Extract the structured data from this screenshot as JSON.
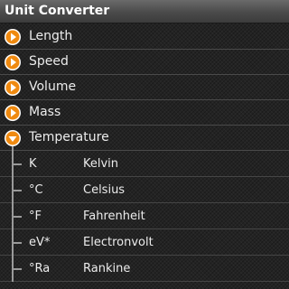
{
  "app": {
    "title": "Unit Converter"
  },
  "colors": {
    "accent": "#f08a10",
    "background": "#232323",
    "divider": "#4a4a4a"
  },
  "categories": [
    {
      "label": "Length",
      "state": "collapsed",
      "icon": "chevron-right-icon"
    },
    {
      "label": "Speed",
      "state": "collapsed",
      "icon": "chevron-right-icon"
    },
    {
      "label": "Volume",
      "state": "collapsed",
      "icon": "chevron-right-icon"
    },
    {
      "label": "Mass",
      "state": "collapsed",
      "icon": "chevron-right-icon"
    },
    {
      "label": "Temperature",
      "state": "expanded",
      "icon": "chevron-down-icon"
    }
  ],
  "units": [
    {
      "symbol": "K",
      "name": "Kelvin"
    },
    {
      "symbol": "°C",
      "name": "Celsius"
    },
    {
      "symbol": "°F",
      "name": "Fahrenheit"
    },
    {
      "symbol": "eV*",
      "name": "Electronvolt"
    },
    {
      "symbol": "°Ra",
      "name": "Rankine"
    }
  ]
}
